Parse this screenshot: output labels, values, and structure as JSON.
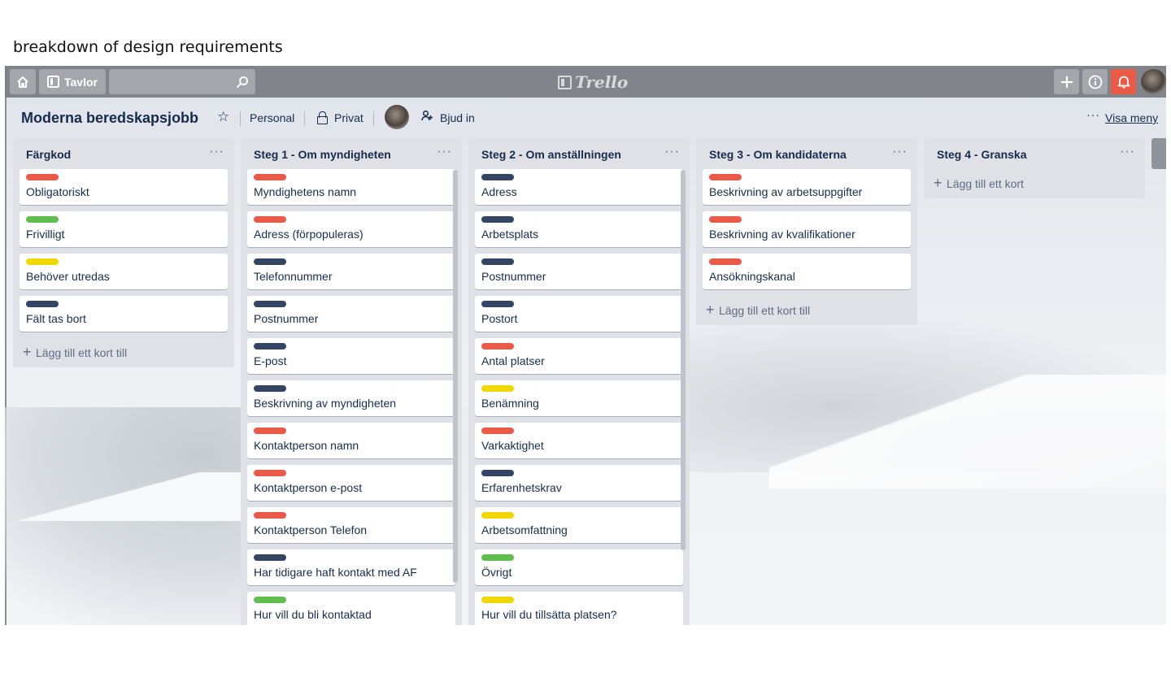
{
  "caption": "breakdown of design requirements",
  "topbar": {
    "boards_label": "Tavlor",
    "logo_text": "Trello"
  },
  "board": {
    "title": "Moderna beredskapsjobb",
    "team": "Personal",
    "visibility": "Privat",
    "invite_label": "Bjud in",
    "menu_dots": "···",
    "menu_label": "Visa meny"
  },
  "colors": {
    "red": "#eb5a46",
    "green": "#61bd4f",
    "yellow": "#f2d600",
    "navy": "#344563"
  },
  "lists": [
    {
      "title": "Färgkod",
      "add_label": "Lägg till ett kort till",
      "cards": [
        {
          "label": "red",
          "text": "Obligatoriskt"
        },
        {
          "label": "green",
          "text": "Frivilligt"
        },
        {
          "label": "yellow",
          "text": "Behöver utredas"
        },
        {
          "label": "navy",
          "text": "Fält tas bort"
        }
      ]
    },
    {
      "title": "Steg 1 - Om myndigheten",
      "add_label": "",
      "cards": [
        {
          "label": "red",
          "text": "Myndighetens namn"
        },
        {
          "label": "red",
          "text": "Adress (förpopuleras)"
        },
        {
          "label": "navy",
          "text": "Telefonnummer"
        },
        {
          "label": "navy",
          "text": "Postnummer"
        },
        {
          "label": "navy",
          "text": "E-post"
        },
        {
          "label": "navy",
          "text": "Beskrivning av myndigheten"
        },
        {
          "label": "red",
          "text": "Kontaktperson namn"
        },
        {
          "label": "red",
          "text": "Kontaktperson e-post"
        },
        {
          "label": "red",
          "text": "Kontaktperson Telefon"
        },
        {
          "label": "navy",
          "text": "Har tidigare haft kontakt med AF"
        },
        {
          "label": "green",
          "text": "Hur vill du bli kontaktad"
        }
      ]
    },
    {
      "title": "Steg 2 - Om anställningen",
      "add_label": "",
      "cards": [
        {
          "label": "navy",
          "text": "Adress"
        },
        {
          "label": "navy",
          "text": "Arbetsplats"
        },
        {
          "label": "navy",
          "text": "Postnummer"
        },
        {
          "label": "navy",
          "text": "Postort"
        },
        {
          "label": "red",
          "text": "Antal platser"
        },
        {
          "label": "yellow",
          "text": "Benämning"
        },
        {
          "label": "red",
          "text": "Varkaktighet"
        },
        {
          "label": "navy",
          "text": "Erfarenhetskrav"
        },
        {
          "label": "yellow",
          "text": "Arbetsomfattning"
        },
        {
          "label": "green",
          "text": "Övrigt"
        },
        {
          "label": "yellow",
          "text": "Hur vill du tillsätta platsen?"
        }
      ]
    },
    {
      "title": "Steg 3 - Om kandidaterna",
      "add_label": "Lägg till ett kort till",
      "cards": [
        {
          "label": "red",
          "text": "Beskrivning av arbetsuppgifter"
        },
        {
          "label": "red",
          "text": "Beskrivning av kvalifikationer"
        },
        {
          "label": "red",
          "text": "Ansökningskanal"
        }
      ]
    },
    {
      "title": "Steg 4 - Granska",
      "add_label": "Lägg till ett kort",
      "cards": []
    }
  ]
}
